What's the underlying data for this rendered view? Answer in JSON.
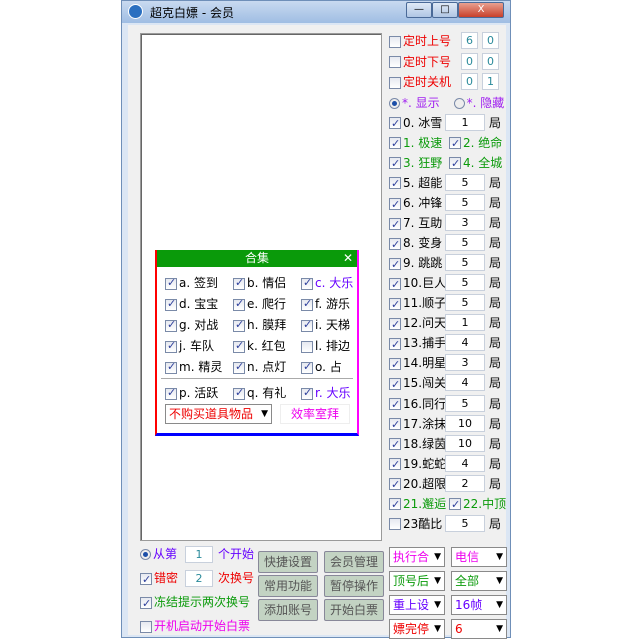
{
  "window": {
    "title": "超克白嫖 - 会员",
    "minimize": "—",
    "maximize": "□",
    "close": "X"
  },
  "right": {
    "timers": [
      {
        "label": "定时上号",
        "a": "6",
        "b": "0",
        "checked": false
      },
      {
        "label": "定时下号",
        "a": "0",
        "b": "0",
        "checked": false
      },
      {
        "label": "定时关机",
        "a": "0",
        "b": "1",
        "checked": false
      }
    ],
    "show": "*. 显示",
    "hide": "*. 隐藏",
    "items": [
      {
        "label": "0. 冰雪",
        "value": "1",
        "checked": true,
        "color": "#000"
      },
      {
        "pair": true,
        "label": "1. 极速",
        "label2": "2. 绝命",
        "color": "#0a9a0a"
      },
      {
        "pair": true,
        "label": "3. 狂野",
        "label2": "4. 全城",
        "color": "#0a9a0a"
      },
      {
        "label": "5. 超能",
        "value": "5",
        "checked": true,
        "color": "#000"
      },
      {
        "label": "6. 冲锋",
        "value": "5",
        "checked": true,
        "color": "#000"
      },
      {
        "label": "7. 互助",
        "value": "3",
        "checked": true,
        "color": "#000"
      },
      {
        "label": "8. 变身",
        "value": "5",
        "checked": true,
        "color": "#000"
      },
      {
        "label": "9. 跳跳",
        "value": "5",
        "checked": true,
        "color": "#000"
      },
      {
        "label": "10.巨人",
        "value": "5",
        "checked": true,
        "color": "#000"
      },
      {
        "label": "11.顺子",
        "value": "5",
        "checked": true,
        "color": "#000"
      },
      {
        "label": "12.问天",
        "value": "1",
        "checked": true,
        "color": "#000"
      },
      {
        "label": "13.捕手",
        "value": "4",
        "checked": true,
        "color": "#000"
      },
      {
        "label": "14.明星",
        "value": "3",
        "checked": true,
        "color": "#000"
      },
      {
        "label": "15.闯关",
        "value": "4",
        "checked": true,
        "color": "#000"
      },
      {
        "label": "16.同行",
        "value": "5",
        "checked": true,
        "color": "#000"
      },
      {
        "label": "17.涂抹",
        "value": "10",
        "checked": true,
        "color": "#000"
      },
      {
        "label": "18.绿茵",
        "value": "10",
        "checked": true,
        "color": "#000"
      },
      {
        "label": "19.蛇蛇",
        "value": "4",
        "checked": true,
        "color": "#000"
      },
      {
        "label": "20.超限",
        "value": "2",
        "checked": true,
        "color": "#000"
      },
      {
        "pair": true,
        "label": "21.邂逅",
        "label2": "22.中顶",
        "color": "#0a9a0a"
      },
      {
        "label": "23酷比",
        "value": "5",
        "checked": false,
        "color": "#000"
      }
    ],
    "unit": "局",
    "selects": [
      [
        "执行合",
        "电信"
      ],
      [
        "顶号后",
        "全部"
      ],
      [
        "重上设",
        "16帧"
      ],
      [
        "嫖完停",
        "6"
      ]
    ]
  },
  "bottom": {
    "from_a": "从第",
    "from_val": "1",
    "from_b": "个开始",
    "err_a": "错密",
    "err_val": "2",
    "err_b": "次换号",
    "freeze": "冻结提示两次换号",
    "autostart": "开机启动开始白票",
    "buttons": [
      "快捷设置",
      "会员管理",
      "常用功能",
      "暂停操作",
      "添加账号",
      "开始白票"
    ]
  },
  "popup": {
    "title": "合集",
    "close": "✕",
    "items": [
      [
        "a. 签到",
        "b. 情侣",
        "c. 大乐"
      ],
      [
        "d. 宝宝",
        "e. 爬行",
        "f. 游乐"
      ],
      [
        "g. 对战",
        "h. 膜拜",
        "i. 天梯"
      ],
      [
        "j. 车队",
        "k. 红包",
        "l. 排边"
      ],
      [
        "m. 精灵",
        "n. 点灯",
        "o. 占"
      ]
    ],
    "items2": [
      "p. 活跃",
      "q. 有礼",
      "r. 大乐"
    ],
    "select": "不购买道具物品",
    "button": "效率室拜"
  }
}
